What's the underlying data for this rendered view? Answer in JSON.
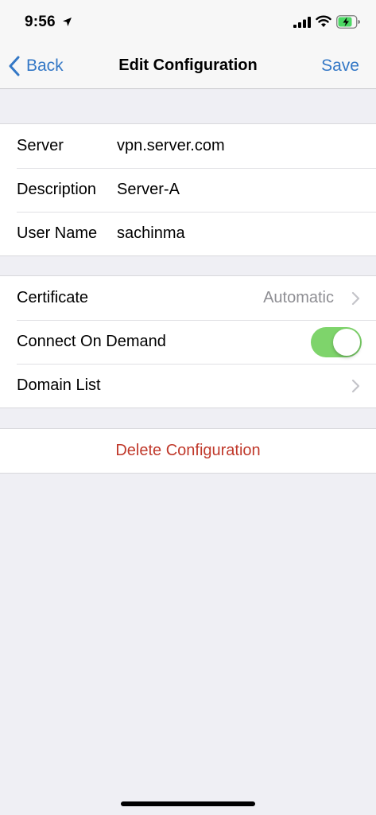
{
  "status_bar": {
    "time": "9:56"
  },
  "nav": {
    "back_label": "Back",
    "title": "Edit Configuration",
    "save_label": "Save"
  },
  "account_group": {
    "rows": [
      {
        "label": "Server",
        "value": "vpn.server.com"
      },
      {
        "label": "Description",
        "value": "Server-A"
      },
      {
        "label": "User Name",
        "value": "sachinma"
      }
    ]
  },
  "options_group": {
    "certificate": {
      "label": "Certificate",
      "value": "Automatic"
    },
    "connect_on_demand": {
      "label": "Connect On Demand",
      "enabled": true
    },
    "domain_list": {
      "label": "Domain List"
    }
  },
  "delete": {
    "label": "Delete Configuration"
  },
  "colors": {
    "accent": "#3478c6",
    "destructive": "#c0392b",
    "toggle_on": "#7ed46b",
    "background": "#efeff4"
  },
  "icons": [
    "location-arrow-icon",
    "cellular-signal-icon",
    "wifi-icon",
    "battery-charging-icon",
    "back-chevron-icon",
    "chevron-right-icon"
  ]
}
